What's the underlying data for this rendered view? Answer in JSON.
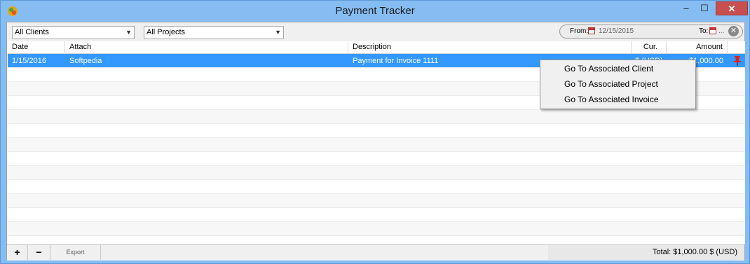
{
  "window": {
    "title": "Payment Tracker",
    "controls": {
      "minimize": "–",
      "maximize": "☐",
      "close": "✕"
    }
  },
  "toolbar": {
    "clients_select": "All Clients",
    "projects_select": "All Projects",
    "from_label": "From:",
    "from_value": "12/15/2015",
    "to_label": "To:",
    "to_value": "...",
    "clear_symbol": "✕"
  },
  "table": {
    "columns": [
      "Date",
      "Attach",
      "Description",
      "Cur.",
      "Amount"
    ],
    "rows": [
      {
        "date": "1/15/2016",
        "attach": "Softpedia",
        "description": "Payment for Invoice 1111",
        "currency": "$ (USD)",
        "amount": "$1,000.00",
        "pinned": true
      }
    ]
  },
  "footer": {
    "add": "+",
    "remove": "−",
    "export": "Export",
    "total": "Total: $1,000.00 $ (USD)"
  },
  "context_menu": {
    "items": [
      "Go To Associated Client",
      "Go To Associated Project",
      "Go To Associated Invoice"
    ]
  },
  "colors": {
    "selection": "#3399ff",
    "titlebar": "#85bdf2",
    "close_button": "#c74f4f",
    "pin": "#e02020"
  }
}
